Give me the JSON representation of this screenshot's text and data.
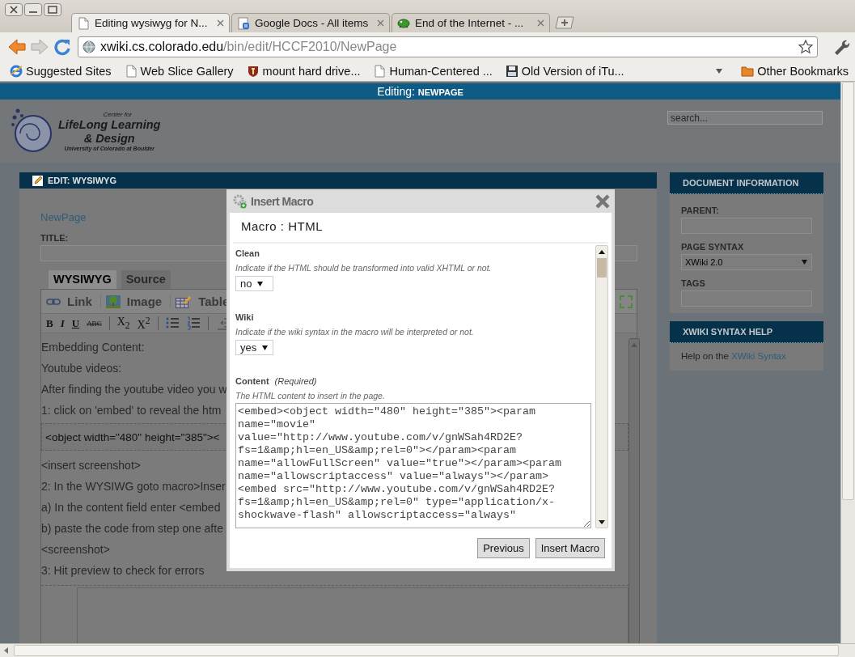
{
  "browser": {
    "tabs": [
      {
        "title": "Editing wysiwyg for N...",
        "selected": true
      },
      {
        "title": "Google Docs - All items",
        "selected": false
      },
      {
        "title": "End of the Internet - ...",
        "selected": false
      }
    ],
    "address": {
      "host": "xwiki.cs.colorado.edu",
      "path": "/bin/edit/HCCF2010/NewPage"
    },
    "bookmarks": [
      "Suggested Sites",
      "Web Slice Gallery",
      "mount hard drive...",
      "Human-Centered ...",
      "Old Version of iTu..."
    ],
    "other_bookmarks": "Other Bookmarks"
  },
  "page": {
    "header": {
      "label": "Editing:",
      "page": "NEWPAGE"
    },
    "logo": {
      "line1": "Center for",
      "line2": "LifeLong Learning",
      "line3": "& Design",
      "line4": "University of Colorado at Boulder"
    },
    "search": {
      "placeholder": "search..."
    },
    "edit_panel": {
      "title": "EDIT: WYSIWYG",
      "page_link": "NewPage",
      "title_label": "TITLE:",
      "editor_tabs": [
        {
          "label": "WYSIWYG",
          "selected": true
        },
        {
          "label": "Source",
          "selected": false
        }
      ],
      "toolbar": [
        "Link",
        "Image",
        "Table"
      ],
      "format_buttons": [
        {
          "kind": "bold",
          "label": "B"
        },
        {
          "kind": "italic",
          "label": "I"
        },
        {
          "kind": "underline",
          "label": "U"
        },
        {
          "kind": "strike",
          "label": "ABC"
        },
        {
          "kind": "sub",
          "label": "X$_{2}$"
        },
        {
          "kind": "sup",
          "label": "X$^{2}$"
        },
        {
          "kind": "bullets"
        },
        {
          "kind": "numbers"
        },
        {
          "kind": "outdent"
        }
      ],
      "content": [
        {
          "kind": "para",
          "text": "Embedding Content:"
        },
        {
          "kind": "para",
          "text": "Youtube videos:"
        },
        {
          "kind": "para",
          "text": "After finding the youtube video you w"
        },
        {
          "kind": "para",
          "text": "1: click on 'embed' to reveal the htm"
        },
        {
          "kind": "code",
          "text": "<object width=\"480\" height=\"385\"><"
        },
        {
          "kind": "para",
          "text": "<insert screenshot>"
        },
        {
          "kind": "para",
          "text": "2: In the WYSIWG goto macro>Inser"
        },
        {
          "kind": "para",
          "text": "a) In the content field enter <embed"
        },
        {
          "kind": "para",
          "text": "b) paste the code from step one afte"
        },
        {
          "kind": "para",
          "text": "<screenshot>"
        },
        {
          "kind": "para",
          "text": "3: Hit preview to check for errors"
        },
        {
          "kind": "frame"
        }
      ]
    },
    "sidebar": [
      {
        "title": "DOCUMENT INFORMATION",
        "fields": [
          {
            "kind": "input",
            "label": "PARENT:"
          },
          {
            "kind": "select",
            "label": "PAGE SYNTAX",
            "value": "XWiki 2.0"
          },
          {
            "kind": "input",
            "label": "TAGS"
          }
        ]
      },
      {
        "title": "XWIKI SYNTAX HELP",
        "text": "Help on the",
        "link": "XWiki Syntax"
      }
    ]
  },
  "dialog": {
    "title": "Insert Macro",
    "heading": "Macro : HTML",
    "params": [
      {
        "kind": "select",
        "label": "Clean",
        "description": "Indicate if the HTML should be transformed into valid XHTML or not.",
        "value": "no"
      },
      {
        "kind": "select",
        "label": "Wiki",
        "description": "Indicate if the wiki syntax in the macro will be interpreted or not.",
        "value": "yes"
      },
      {
        "kind": "textarea",
        "label": "Content",
        "note": "(Required)",
        "description": "The HTML content to insert in the page.",
        "value": "<embed><object width=\"480\" height=\"385\"><param name=\"movie\" value=\"http://www.youtube.com/v/gnWSah4RD2E?fs=1&amp;hl=en_US&amp;rel=0\"></param><param name=\"allowFullScreen\" value=\"true\"></param><param name=\"allowscriptaccess\" value=\"always\"></param><embed src=\"http://www.youtube.com/v/gnWSah4RD2E?fs=1&amp;hl=en_US&amp;rel=0\" type=\"application/x-shockwave-flash\" allowscriptaccess=\"always\""
      }
    ],
    "buttons": [
      "Previous",
      "Insert Macro"
    ]
  }
}
